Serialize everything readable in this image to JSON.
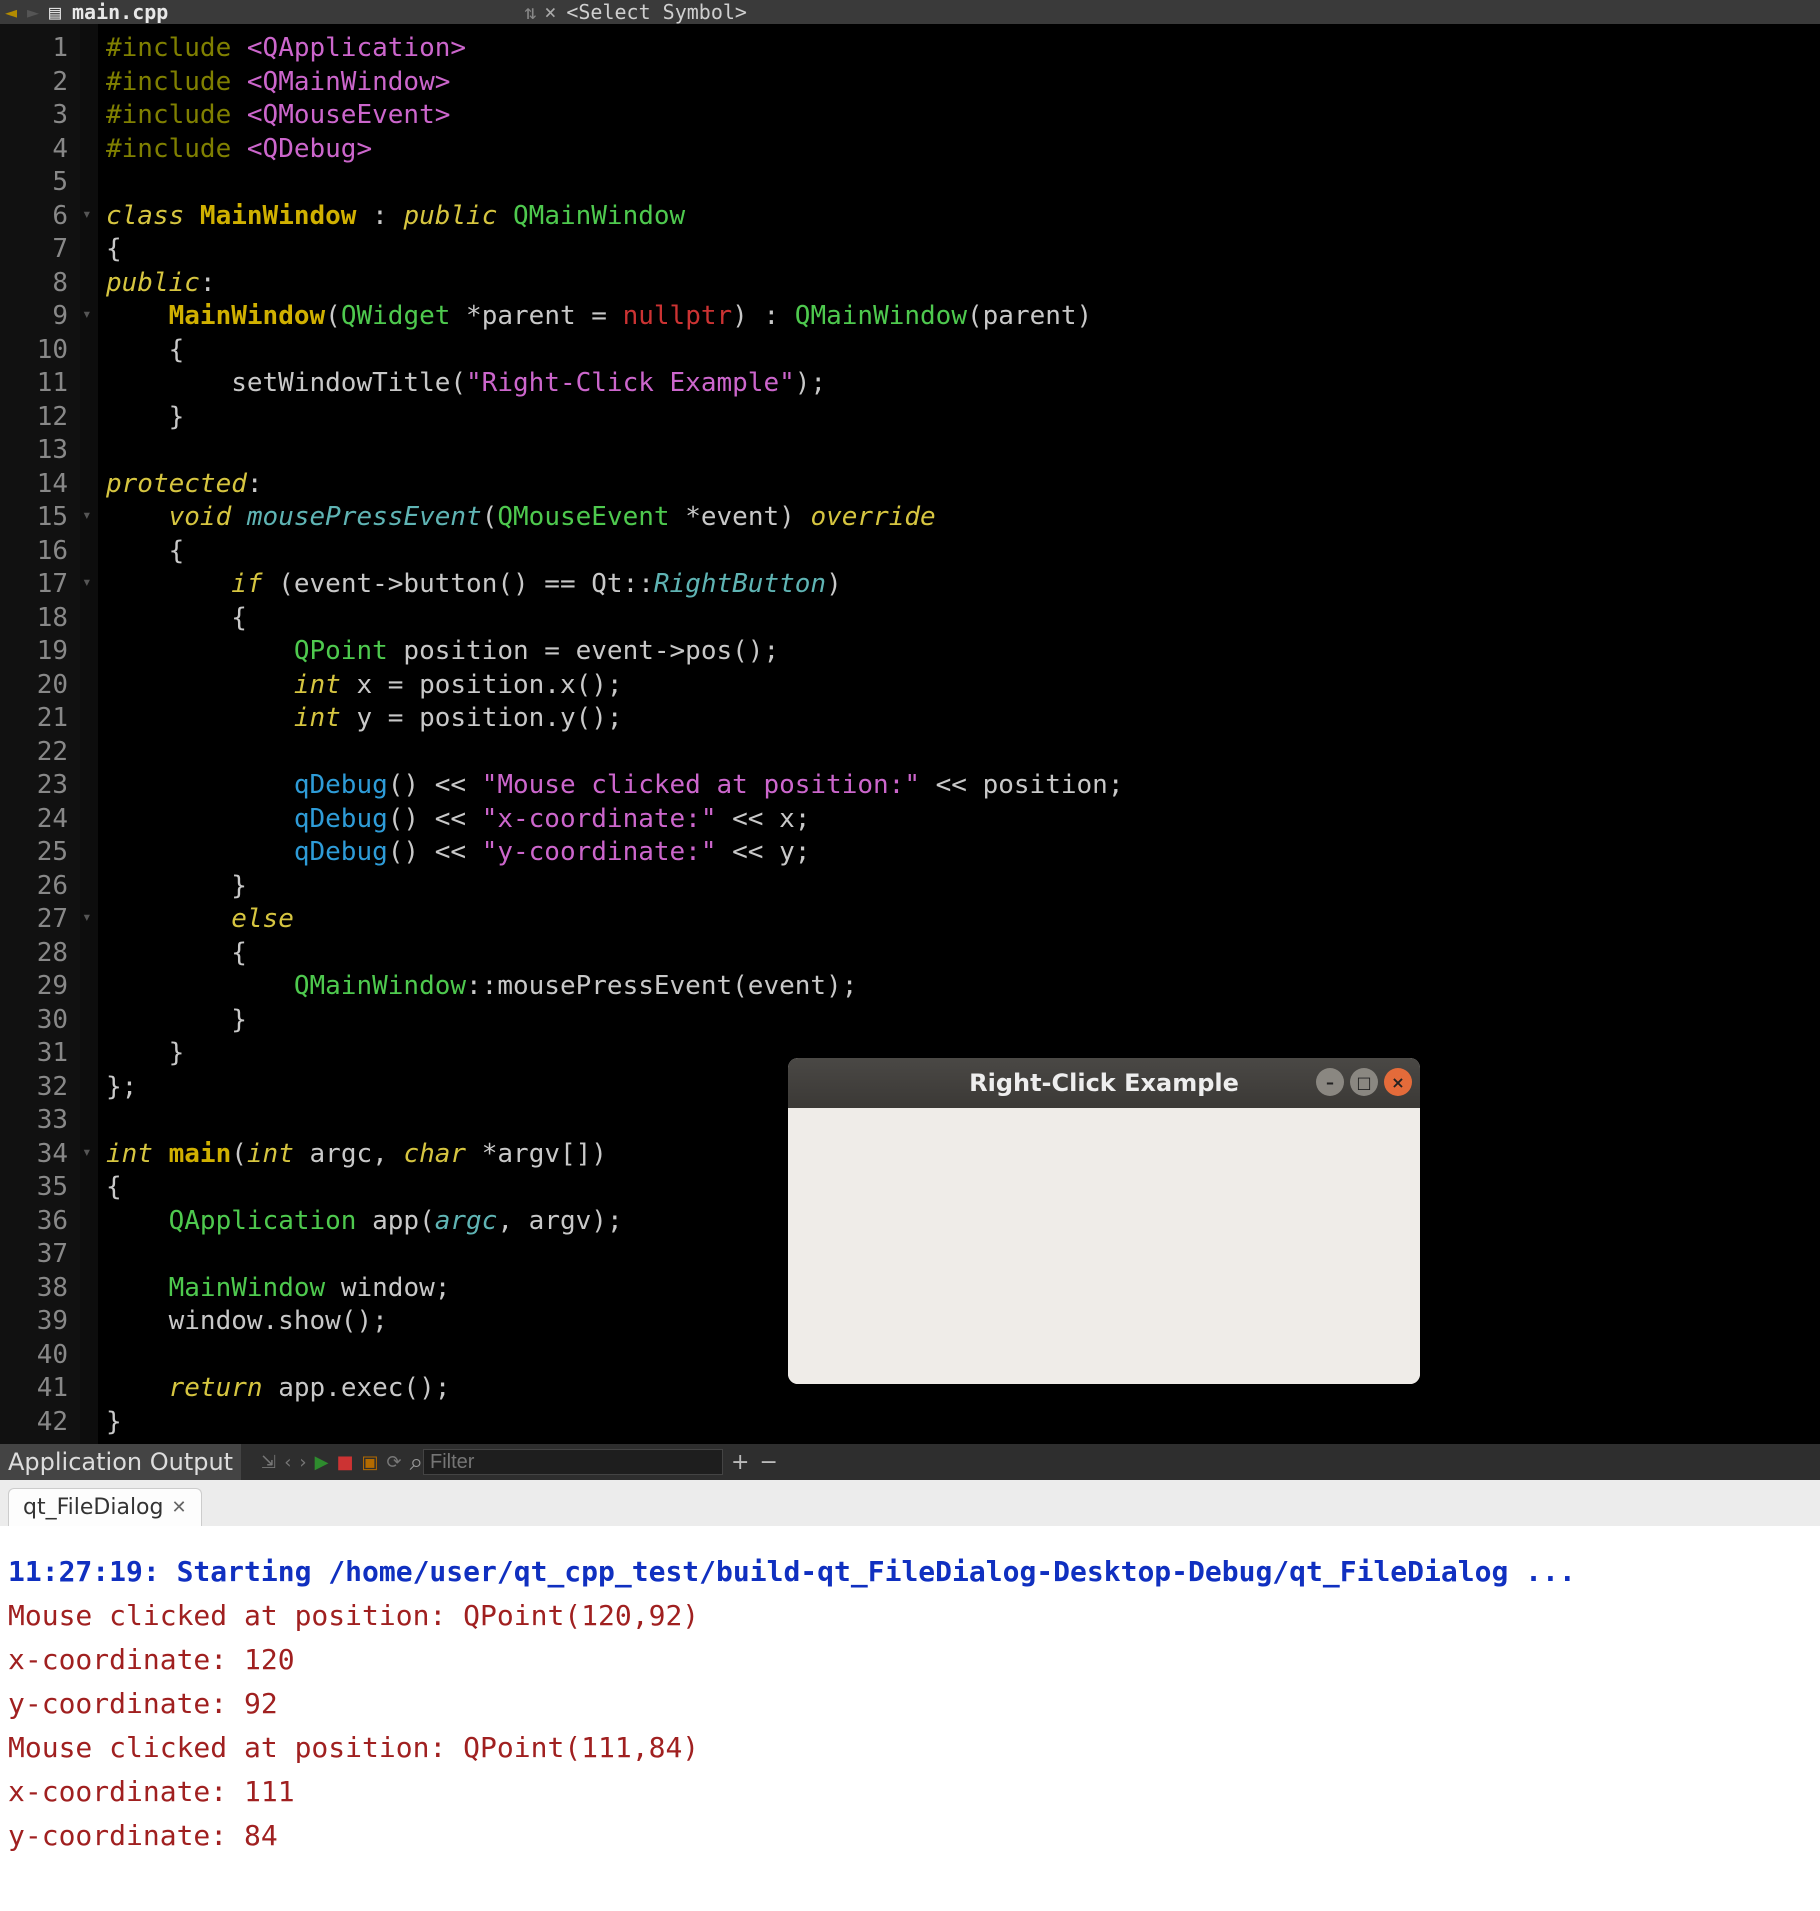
{
  "tabstrip": {
    "file_name": "main.cpp",
    "symbol_placeholder": "<Select Symbol>"
  },
  "code_lines": [
    [
      {
        "c": "kw-pp",
        "t": "#include "
      },
      {
        "c": "inc",
        "t": "<QApplication>"
      }
    ],
    [
      {
        "c": "kw-pp",
        "t": "#include "
      },
      {
        "c": "inc",
        "t": "<QMainWindow>"
      }
    ],
    [
      {
        "c": "kw-pp",
        "t": "#include "
      },
      {
        "c": "inc",
        "t": "<QMouseEvent>"
      }
    ],
    [
      {
        "c": "kw-pp",
        "t": "#include "
      },
      {
        "c": "inc",
        "t": "<QDebug>"
      }
    ],
    [],
    [
      {
        "c": "kw",
        "t": "class "
      },
      {
        "c": "name-def",
        "t": "MainWindow"
      },
      {
        "c": "default",
        "t": " : "
      },
      {
        "c": "kw",
        "t": "public "
      },
      {
        "c": "type",
        "t": "QMainWindow"
      }
    ],
    [
      {
        "c": "default",
        "t": "{"
      }
    ],
    [
      {
        "c": "kw",
        "t": "public"
      },
      {
        "c": "default",
        "t": ":"
      }
    ],
    [
      {
        "c": "default",
        "t": "    "
      },
      {
        "c": "name-def",
        "t": "MainWindow"
      },
      {
        "c": "default",
        "t": "("
      },
      {
        "c": "type",
        "t": "QWidget"
      },
      {
        "c": "default",
        "t": " *parent = "
      },
      {
        "c": "lit",
        "t": "nullptr"
      },
      {
        "c": "default",
        "t": ") : "
      },
      {
        "c": "type",
        "t": "QMainWindow"
      },
      {
        "c": "default",
        "t": "(parent)"
      }
    ],
    [
      {
        "c": "default",
        "t": "    {"
      }
    ],
    [
      {
        "c": "default",
        "t": "        setWindowTitle("
      },
      {
        "c": "str",
        "t": "\"Right-Click Example\""
      },
      {
        "c": "default",
        "t": ");"
      }
    ],
    [
      {
        "c": "default",
        "t": "    }"
      }
    ],
    [],
    [
      {
        "c": "kw",
        "t": "protected"
      },
      {
        "c": "default",
        "t": ":"
      }
    ],
    [
      {
        "c": "default",
        "t": "    "
      },
      {
        "c": "kw",
        "t": "void "
      },
      {
        "c": "arg-it",
        "t": "mousePressEvent"
      },
      {
        "c": "default",
        "t": "("
      },
      {
        "c": "type",
        "t": "QMouseEvent"
      },
      {
        "c": "default",
        "t": " *event) "
      },
      {
        "c": "kw",
        "t": "override"
      }
    ],
    [
      {
        "c": "default",
        "t": "    {"
      }
    ],
    [
      {
        "c": "default",
        "t": "        "
      },
      {
        "c": "kw",
        "t": "if"
      },
      {
        "c": "default",
        "t": " (event->button() == Qt::"
      },
      {
        "c": "arg-it",
        "t": "RightButton"
      },
      {
        "c": "default",
        "t": ")"
      }
    ],
    [
      {
        "c": "default",
        "t": "        {"
      }
    ],
    [
      {
        "c": "default",
        "t": "            "
      },
      {
        "c": "type",
        "t": "QPoint"
      },
      {
        "c": "default",
        "t": " position = event->pos();"
      }
    ],
    [
      {
        "c": "default",
        "t": "            "
      },
      {
        "c": "kw",
        "t": "int"
      },
      {
        "c": "default",
        "t": " x = position.x();"
      }
    ],
    [
      {
        "c": "default",
        "t": "            "
      },
      {
        "c": "kw",
        "t": "int"
      },
      {
        "c": "default",
        "t": " y = position.y();"
      }
    ],
    [],
    [
      {
        "c": "default",
        "t": "            "
      },
      {
        "c": "call",
        "t": "qDebug"
      },
      {
        "c": "default",
        "t": "() << "
      },
      {
        "c": "str",
        "t": "\"Mouse clicked at position:\""
      },
      {
        "c": "default",
        "t": " << position;"
      }
    ],
    [
      {
        "c": "default",
        "t": "            "
      },
      {
        "c": "call",
        "t": "qDebug"
      },
      {
        "c": "default",
        "t": "() << "
      },
      {
        "c": "str",
        "t": "\"x-coordinate:\""
      },
      {
        "c": "default",
        "t": " << x;"
      }
    ],
    [
      {
        "c": "default",
        "t": "            "
      },
      {
        "c": "call",
        "t": "qDebug"
      },
      {
        "c": "default",
        "t": "() << "
      },
      {
        "c": "str",
        "t": "\"y-coordinate:\""
      },
      {
        "c": "default",
        "t": " << y;"
      }
    ],
    [
      {
        "c": "default",
        "t": "        }"
      }
    ],
    [
      {
        "c": "default",
        "t": "        "
      },
      {
        "c": "kw",
        "t": "else"
      }
    ],
    [
      {
        "c": "default",
        "t": "        {"
      }
    ],
    [
      {
        "c": "default",
        "t": "            "
      },
      {
        "c": "type",
        "t": "QMainWindow"
      },
      {
        "c": "default",
        "t": "::mousePressEvent(event);"
      }
    ],
    [
      {
        "c": "default",
        "t": "        }"
      }
    ],
    [
      {
        "c": "default",
        "t": "    }"
      }
    ],
    [
      {
        "c": "default",
        "t": "};"
      }
    ],
    [],
    [
      {
        "c": "kw",
        "t": "int "
      },
      {
        "c": "name-def",
        "t": "main"
      },
      {
        "c": "default",
        "t": "("
      },
      {
        "c": "kw",
        "t": "int"
      },
      {
        "c": "default",
        "t": " argc, "
      },
      {
        "c": "kw",
        "t": "char"
      },
      {
        "c": "default",
        "t": " *argv[])"
      }
    ],
    [
      {
        "c": "default",
        "t": "{"
      }
    ],
    [
      {
        "c": "default",
        "t": "    "
      },
      {
        "c": "type",
        "t": "QApplication"
      },
      {
        "c": "default",
        "t": " app("
      },
      {
        "c": "arg-it",
        "t": "argc"
      },
      {
        "c": "default",
        "t": ", argv);"
      }
    ],
    [],
    [
      {
        "c": "default",
        "t": "    "
      },
      {
        "c": "type",
        "t": "MainWindow"
      },
      {
        "c": "default",
        "t": " window;"
      }
    ],
    [
      {
        "c": "default",
        "t": "    window.show();"
      }
    ],
    [],
    [
      {
        "c": "default",
        "t": "    "
      },
      {
        "c": "kw",
        "t": "return"
      },
      {
        "c": "default",
        "t": " app.exec();"
      }
    ],
    [
      {
        "c": "default",
        "t": "}"
      }
    ]
  ],
  "fold_rows": [
    6,
    9,
    15,
    17,
    27,
    34
  ],
  "output_header": {
    "title": "Application Output",
    "filter_placeholder": "Filter"
  },
  "output_tab": {
    "label": "qt_FileDialog"
  },
  "console_lines": [
    {
      "cls": "start",
      "t": "11:27:19: Starting /home/user/qt_cpp_test/build-qt_FileDialog-Desktop-Debug/qt_FileDialog ..."
    },
    {
      "cls": "dbg",
      "t": "Mouse clicked at position: QPoint(120,92)"
    },
    {
      "cls": "dbg",
      "t": "x-coordinate: 120"
    },
    {
      "cls": "dbg",
      "t": "y-coordinate: 92"
    },
    {
      "cls": "dbg",
      "t": "Mouse clicked at position: QPoint(111,84)"
    },
    {
      "cls": "dbg",
      "t": "x-coordinate: 111"
    },
    {
      "cls": "dbg",
      "t": "y-coordinate: 84"
    }
  ],
  "example_window": {
    "title": "Right-Click Example"
  }
}
